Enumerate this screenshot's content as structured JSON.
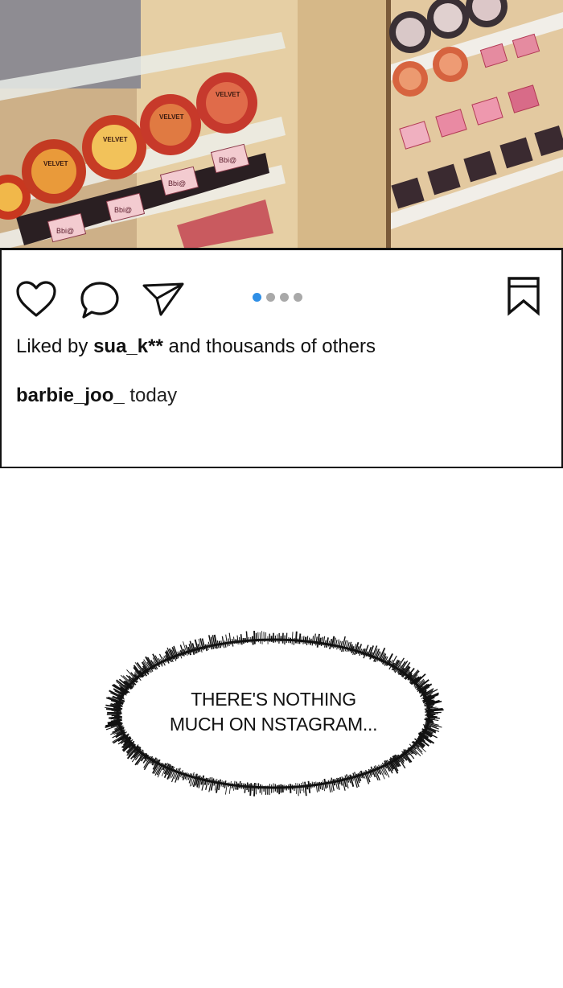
{
  "post": {
    "image_description_icons": "makeup-display-shelf",
    "product_labels": {
      "compact_brand": "VELVET",
      "palette_brand": "Bbi@"
    },
    "actions": {
      "like_icon": "heart-icon",
      "comment_icon": "comment-icon",
      "share_icon": "send-icon",
      "save_icon": "bookmark-icon"
    },
    "carousel": {
      "total": 4,
      "active_index": 0,
      "active_color": "#2f8fe6",
      "inactive_color": "#a9a9a9"
    },
    "likes": {
      "prefix": "Liked by",
      "user": "sua_k**",
      "suffix": "and thousands of others"
    },
    "caption": {
      "username": "barbie_joo_",
      "time": "today"
    }
  },
  "speech_bubble": {
    "line1": "THERE'S NOTHING",
    "line2": "MUCH ON NSTAGRAM..."
  }
}
